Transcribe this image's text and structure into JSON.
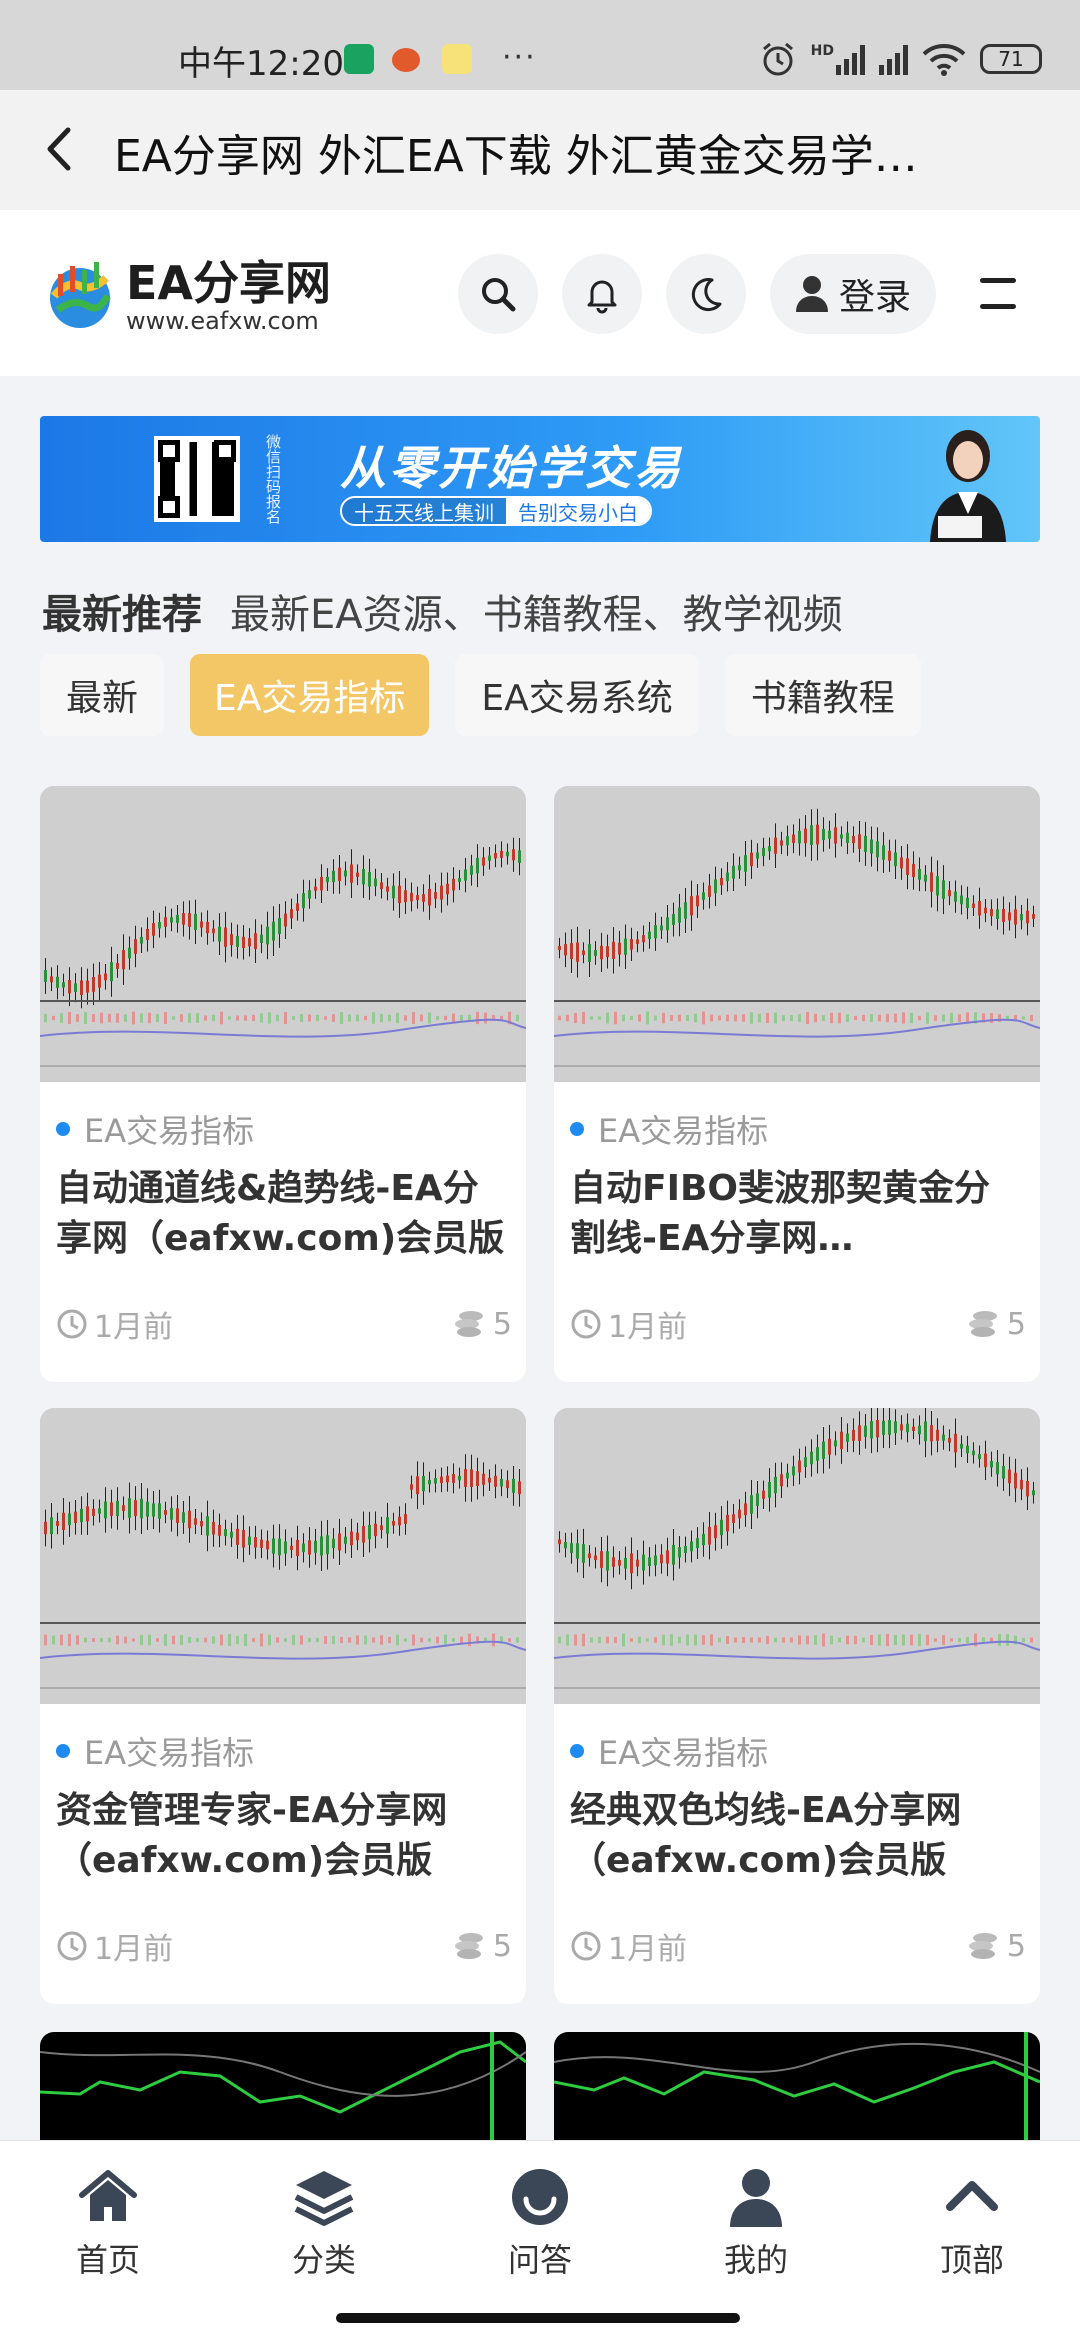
{
  "status_bar": {
    "time": "中午12:20",
    "battery": "71",
    "dots": "···",
    "network": "HD",
    "colors": {
      "vpn": "#1aa260",
      "note": "#f7e27a",
      "app": "#e05a2b"
    }
  },
  "title_bar": {
    "title": "EA分享网 外汇EA下载 外汇黄金交易学…"
  },
  "header": {
    "logo_name": "EA分享网",
    "logo_url": "www.eafxw.com",
    "login_label": "登录",
    "icons": [
      "search-icon",
      "bell-icon",
      "moon-icon",
      "user-icon",
      "menu-icon"
    ]
  },
  "banner": {
    "headline": "从零开始学交易",
    "pill_left": "十五天线上集训",
    "pill_right": "告别交易小白",
    "side_text": "微信扫码报名"
  },
  "section": {
    "title": "最新推荐",
    "subtitle": "最新EA资源、书籍教程、教学视频"
  },
  "tabs": [
    {
      "label": "最新",
      "active": false
    },
    {
      "label": "EA交易指标",
      "active": true
    },
    {
      "label": "EA交易系统",
      "active": false
    },
    {
      "label": "书籍教程",
      "active": false
    }
  ],
  "cards": [
    {
      "category": "EA交易指标",
      "title": "自动通道线&趋势线-EA分享网（eafxw.com)会员版",
      "time": "1月前",
      "coins": "5"
    },
    {
      "category": "EA交易指标",
      "title": "自动FIBO斐波那契黄金分割线-EA分享网…",
      "time": "1月前",
      "coins": "5"
    },
    {
      "category": "EA交易指标",
      "title": "资金管理专家-EA分享网（eafxw.com)会员版",
      "time": "1月前",
      "coins": "5"
    },
    {
      "category": "EA交易指标",
      "title": "经典双色均线-EA分享网（eafxw.com)会员版",
      "time": "1月前",
      "coins": "5"
    }
  ],
  "bottom_nav": [
    {
      "label": "首页",
      "icon": "home-icon"
    },
    {
      "label": "分类",
      "icon": "layers-icon"
    },
    {
      "label": "问答",
      "icon": "smile-icon"
    },
    {
      "label": "我的",
      "icon": "person-icon"
    },
    {
      "label": "顶部",
      "icon": "chevron-up-icon"
    }
  ],
  "colors": {
    "accent_tab": "#f4c766",
    "category_dot": "#1d8bf0",
    "banner_blue": "#1c78e6"
  }
}
